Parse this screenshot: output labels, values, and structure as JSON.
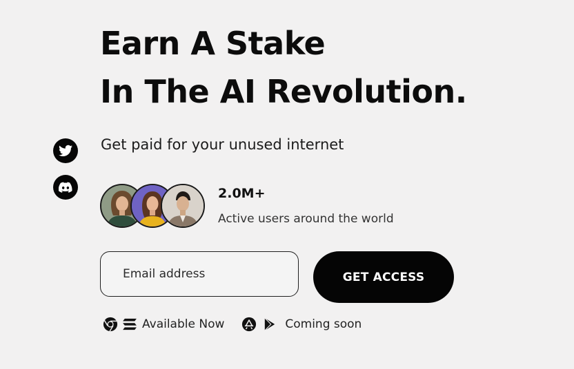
{
  "hero": {
    "headline_line1": "Earn A Stake",
    "headline_line2": "In The AI Revolution.",
    "tagline": "Get paid for your unused internet"
  },
  "social": [
    {
      "icon": "twitter-icon"
    },
    {
      "icon": "discord-icon"
    }
  ],
  "stats": {
    "value": "2.0M+",
    "label": "Active users around the world"
  },
  "signup": {
    "email_placeholder": "Email address",
    "cta_label": "GET ACCESS"
  },
  "platforms": {
    "available_icons": [
      "chrome-icon",
      "solana-icon"
    ],
    "available_label": "Available Now",
    "coming_icons": [
      "apple-app-store-icon",
      "google-play-icon"
    ],
    "coming_label": "Coming soon"
  },
  "colors": {
    "background": "#f2f1f1",
    "text": "#111111",
    "button": "#050505",
    "button_text": "#ffffff"
  }
}
